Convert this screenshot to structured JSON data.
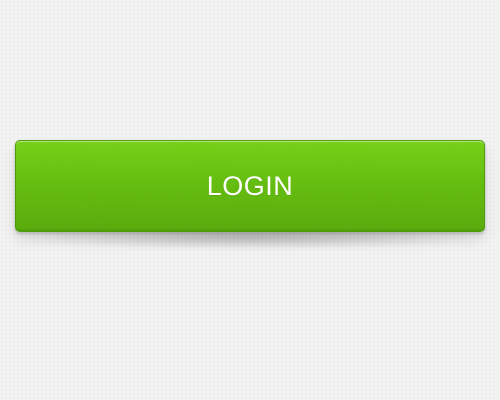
{
  "login_button": {
    "label": "LOGIN"
  },
  "colors": {
    "background": "#f1f1f1",
    "button_top": "#76cf16",
    "button_bottom": "#57aa0a",
    "button_border": "#4e9c0b",
    "label": "#ffffff"
  }
}
